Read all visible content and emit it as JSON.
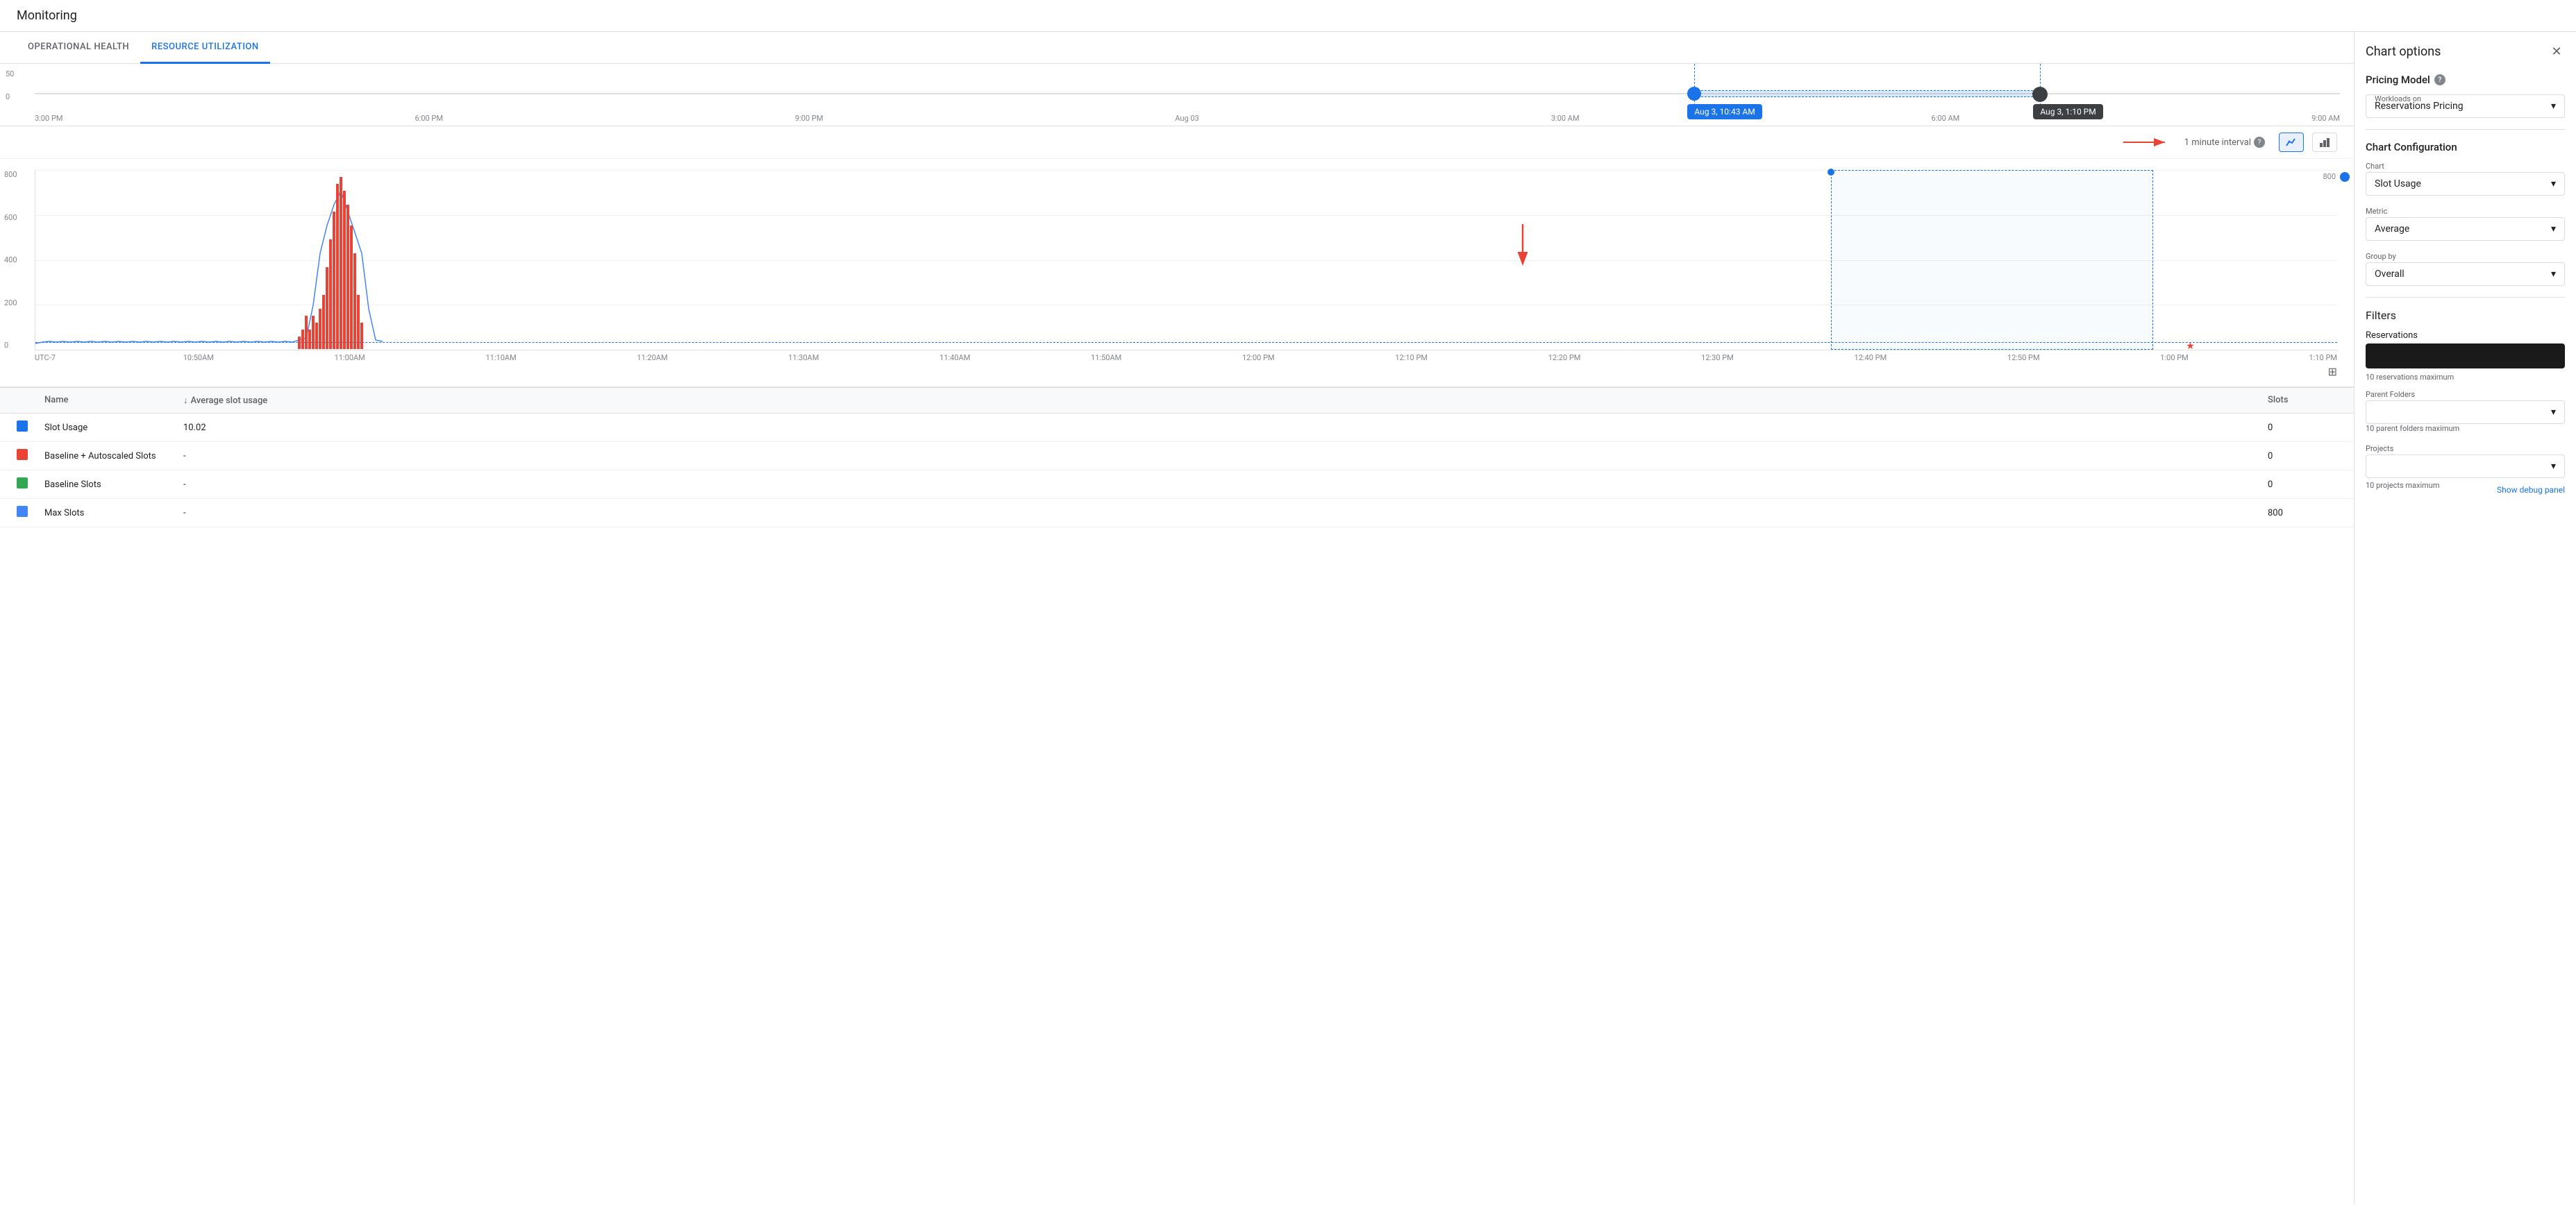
{
  "app": {
    "title": "Monitoring"
  },
  "tabs": [
    {
      "id": "operational-health",
      "label": "OPERATIONAL HEALTH",
      "active": false
    },
    {
      "id": "resource-utilization",
      "label": "RESOURCE UTILIZATION",
      "active": true
    }
  ],
  "overview_chart": {
    "y_labels": [
      "50",
      "0"
    ],
    "x_labels": [
      "3:00 PM",
      "6:00 PM",
      "9:00 PM",
      "Aug 03",
      "3:00 AM",
      "6:00 AM",
      "9:00 AM"
    ],
    "tooltip_left": "Aug 3, 10:43 AM",
    "tooltip_right": "Aug 3, 1:10 PM"
  },
  "chart_controls": {
    "interval_label": "1 minute interval"
  },
  "main_chart": {
    "y_labels": [
      "800",
      "600",
      "400",
      "200",
      "0"
    ],
    "x_labels": [
      "UTC-7",
      "10:50AM",
      "11:00AM",
      "11:10AM",
      "11:20AM",
      "11:30AM",
      "11:40AM",
      "11:50AM",
      "12:00 PM",
      "12:10 PM",
      "12:20 PM",
      "12:30 PM",
      "12:40 PM",
      "12:50 PM",
      "1:00 PM",
      "1:10 PM"
    ]
  },
  "table": {
    "headers": [
      "",
      "Name",
      "Average slot usage",
      "Slots"
    ],
    "rows": [
      {
        "color": "#1a73e8",
        "name": "Slot Usage",
        "avg": "10.02",
        "slots": "0"
      },
      {
        "color": "#ea4335",
        "name": "Baseline + Autoscaled Slots",
        "avg": "-",
        "slots": "0"
      },
      {
        "color": "#34a853",
        "name": "Baseline Slots",
        "avg": "-",
        "slots": "0"
      },
      {
        "color": "#4285f4",
        "name": "Max Slots",
        "avg": "-",
        "slots": "800"
      }
    ]
  },
  "right_panel": {
    "title": "Chart options",
    "pricing_model": {
      "label": "Pricing Model",
      "workloads_label": "Workloads on",
      "workloads_value": "Reservations Pricing"
    },
    "chart_config": {
      "label": "Chart Configuration",
      "chart_label": "Chart",
      "chart_value": "Slot Usage",
      "metric_label": "Metric",
      "metric_value": "Average",
      "group_by_label": "Group by",
      "group_by_value": "Overall"
    },
    "filters": {
      "label": "Filters",
      "reservations_label": "Reservations",
      "reservations_max": "10 reservations maximum",
      "parent_folders_label": "Parent Folders",
      "parent_folders_max": "10 parent folders maximum",
      "projects_label": "Projects",
      "projects_max": "10 projects maximum",
      "debug_label": "Show debug panel"
    }
  }
}
